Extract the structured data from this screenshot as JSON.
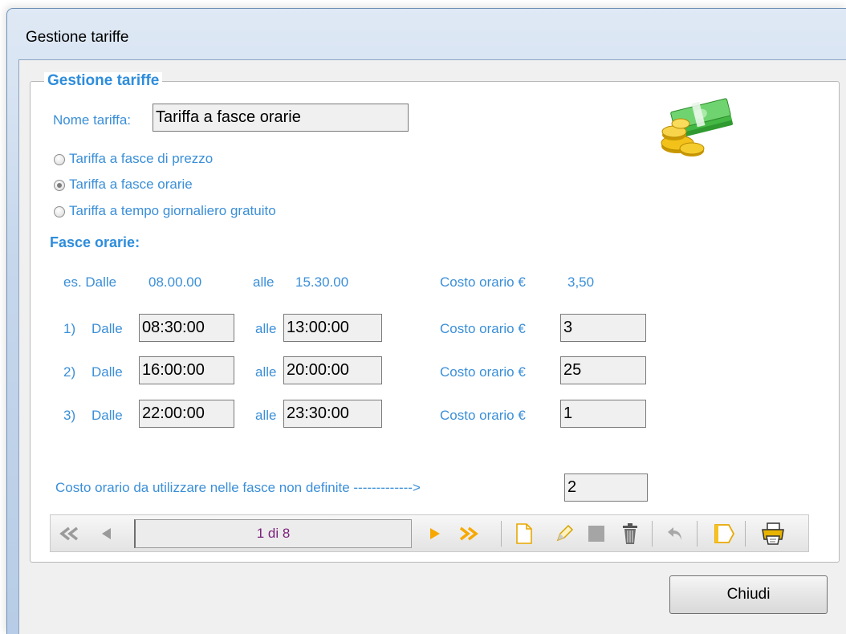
{
  "window": {
    "title": "Gestione tariffe"
  },
  "group": {
    "legend": "Gestione tariffe"
  },
  "name": {
    "label": "Nome tariffa:",
    "value": "Tariffa a fasce orarie"
  },
  "tariff_types": [
    {
      "label": "Tariffa a fasce di prezzo",
      "selected": false
    },
    {
      "label": "Tariffa a fasce orarie",
      "selected": true
    },
    {
      "label": "Tariffa a tempo giornaliero gratuito",
      "selected": false
    }
  ],
  "bands_title": "Fasce orarie:",
  "example": {
    "dalle_label": "es. Dalle",
    "dalle_value": "08.00.00",
    "alle_label": "alle",
    "alle_value": "15.30.00",
    "cost_label": "Costo orario €",
    "cost_value": "3,50"
  },
  "bands": [
    {
      "index": "1)",
      "dalle_label": "Dalle",
      "from": "08:30:00",
      "alle_label": "alle",
      "to": "13:00:00",
      "cost_label": "Costo orario €",
      "cost": "3"
    },
    {
      "index": "2)",
      "dalle_label": "Dalle",
      "from": "16:00:00",
      "alle_label": "alle",
      "to": "20:00:00",
      "cost_label": "Costo orario €",
      "cost": "25"
    },
    {
      "index": "3)",
      "dalle_label": "Dalle",
      "from": "22:00:00",
      "alle_label": "alle",
      "to": "23:30:00",
      "cost_label": "Costo orario €",
      "cost": "1"
    }
  ],
  "undefined_cost": {
    "label": "Costo orario da utilizzare nelle fasce non definite ------------->",
    "value": "2"
  },
  "navigator": {
    "counter": "1 di 8",
    "icons": [
      "first-record-icon",
      "prev-record-icon",
      "next-record-icon",
      "last-record-icon",
      "new-record-icon",
      "edit-record-icon",
      "save-record-icon",
      "delete-record-icon",
      "undo-icon",
      "bookmark-icon",
      "print-icon"
    ]
  },
  "close_label": "Chiudi",
  "colors": {
    "label_blue": "#3b8fd8",
    "legend_blue": "#2e8ddc",
    "nav_orange": "#f7a800",
    "counter_purple": "#7b1f7b"
  }
}
